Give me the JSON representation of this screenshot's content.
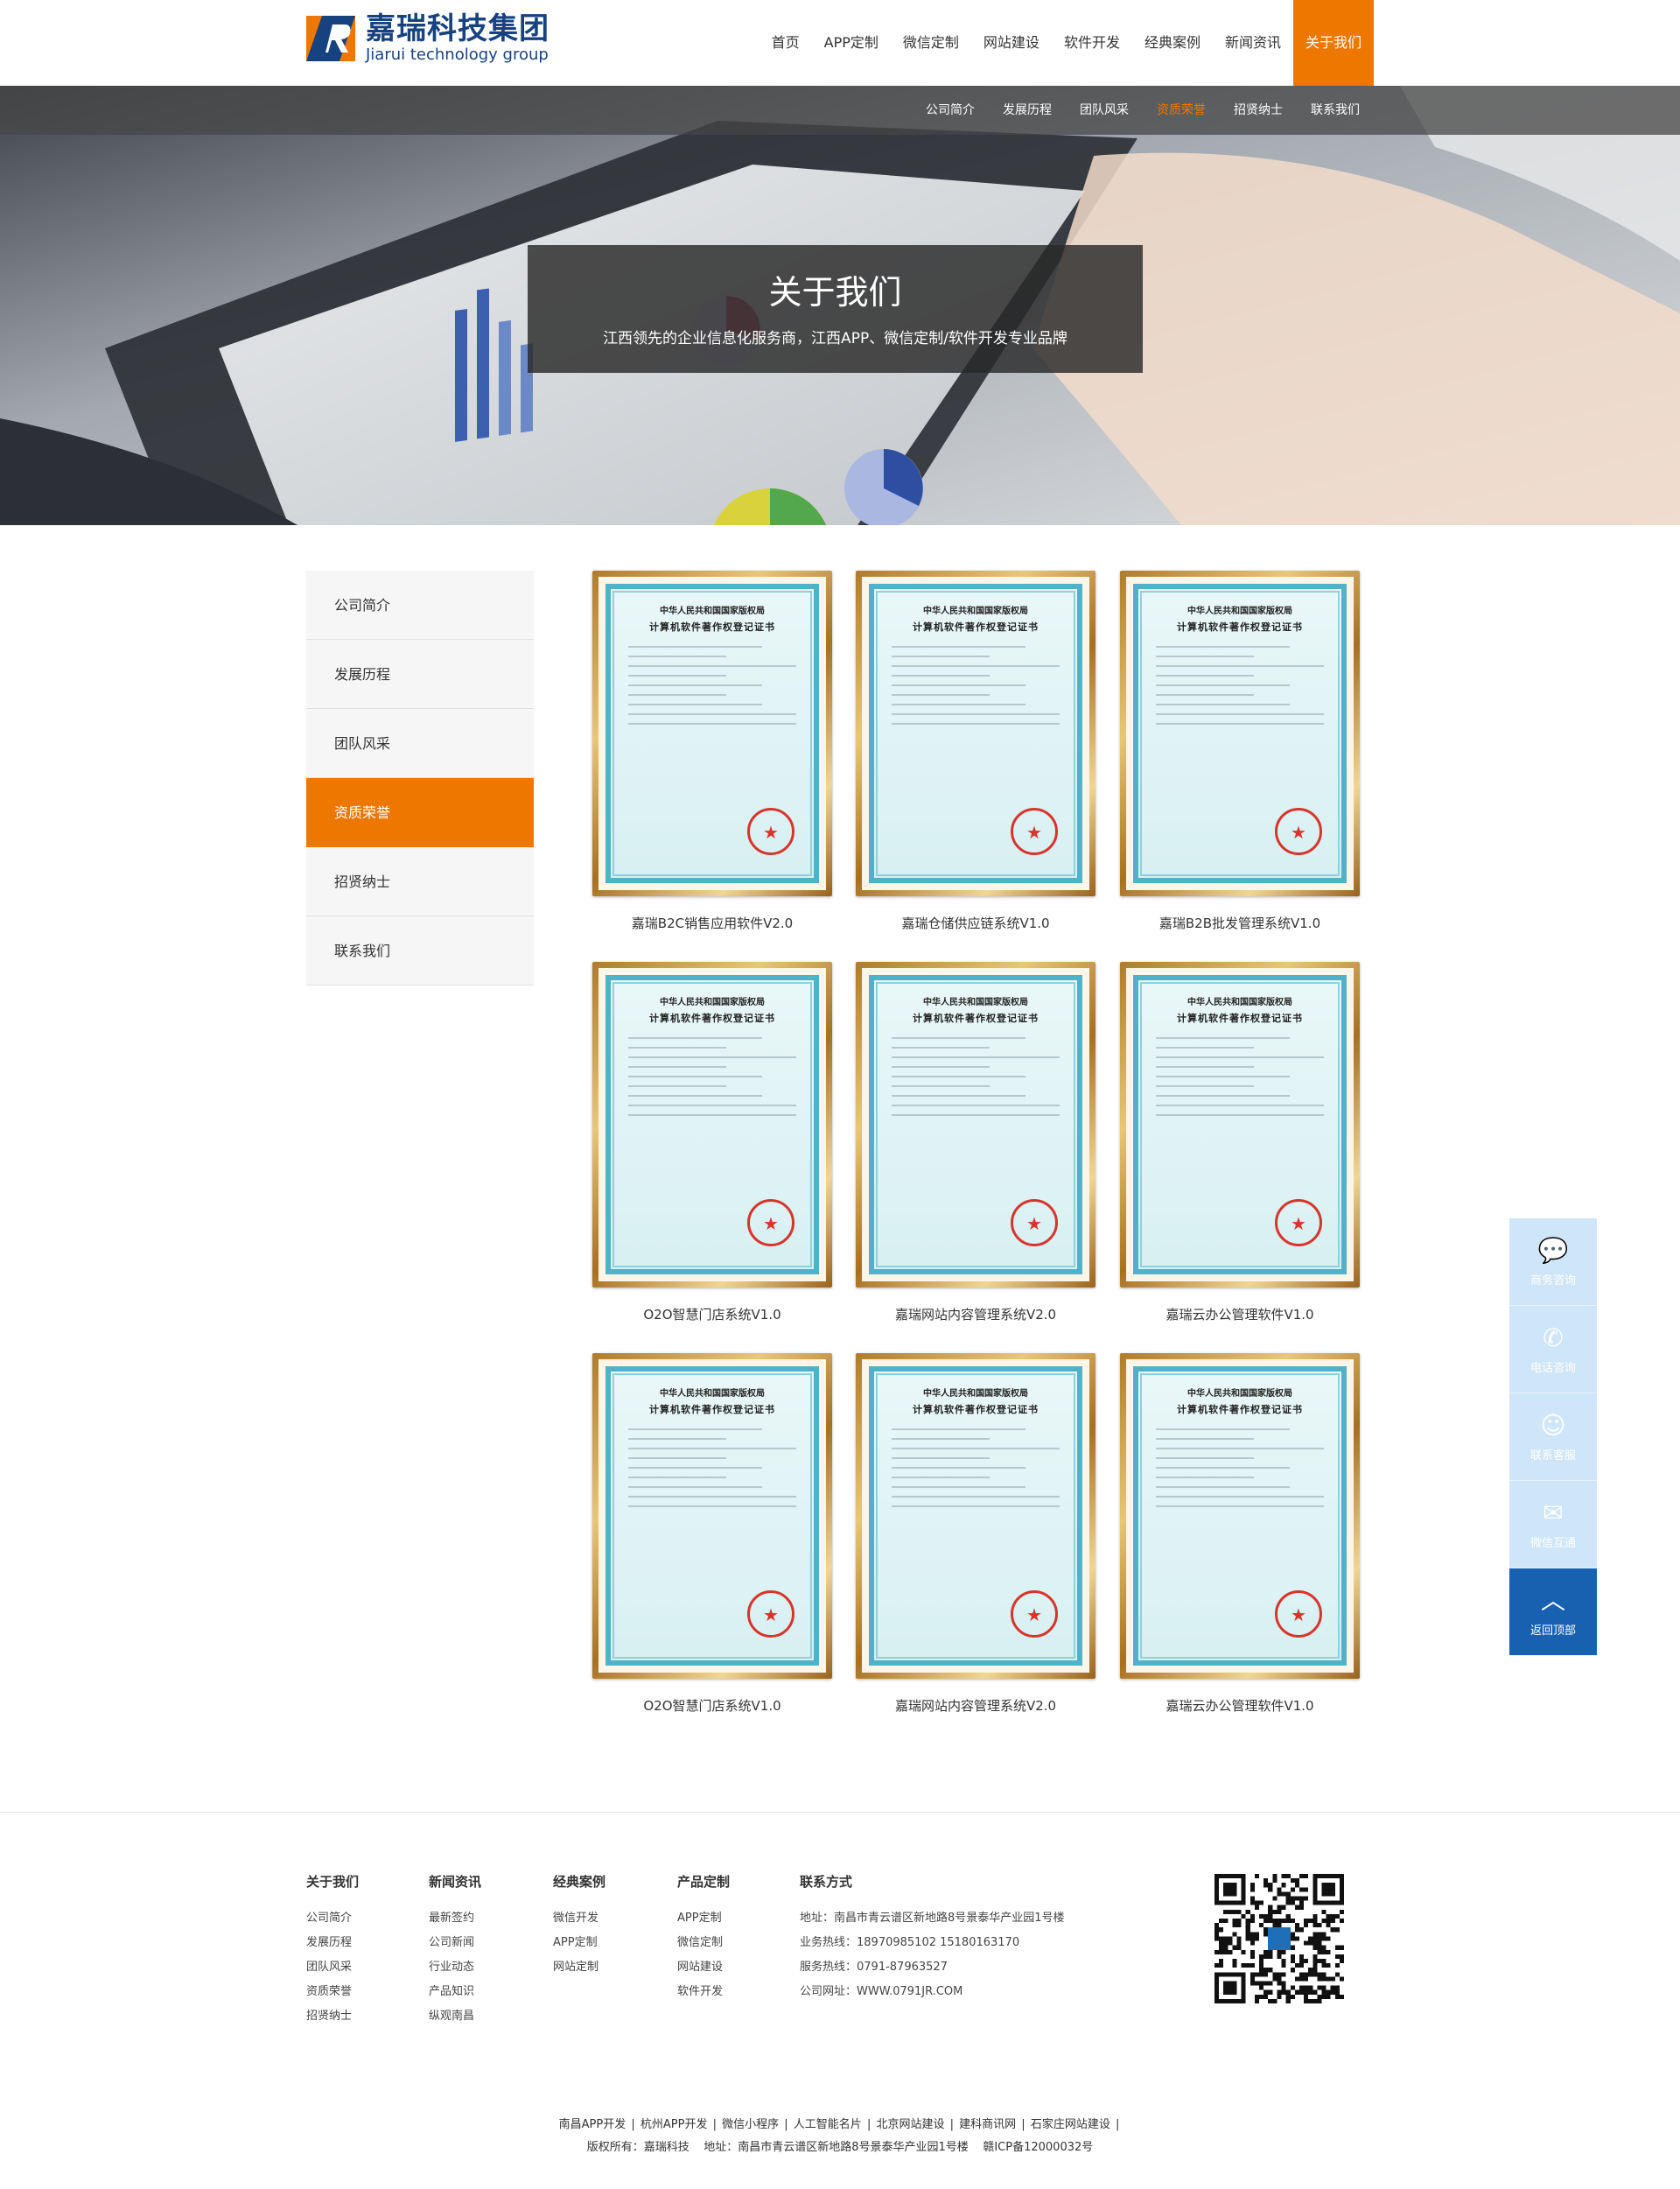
{
  "brand": {
    "cn": "嘉瑞科技集团",
    "en": "Jiarui technology group"
  },
  "nav": [
    {
      "label": "首页"
    },
    {
      "label": "APP定制"
    },
    {
      "label": "微信定制"
    },
    {
      "label": "网站建设"
    },
    {
      "label": "软件开发"
    },
    {
      "label": "经典案例"
    },
    {
      "label": "新闻资讯"
    },
    {
      "label": "关于我们",
      "active": true
    }
  ],
  "subnav": [
    {
      "label": "公司简介"
    },
    {
      "label": "发展历程"
    },
    {
      "label": "团队风采"
    },
    {
      "label": "资质荣誉",
      "active": true
    },
    {
      "label": "招贤纳士"
    },
    {
      "label": "联系我们"
    }
  ],
  "banner": {
    "title": "关于我们",
    "subtitle": "江西领先的企业信息化服务商，江西APP、微信定制/软件开发专业品牌"
  },
  "sidebar": [
    {
      "label": "公司简介"
    },
    {
      "label": "发展历程"
    },
    {
      "label": "团队风采"
    },
    {
      "label": "资质荣誉",
      "active": true
    },
    {
      "label": "招贤纳士"
    },
    {
      "label": "联系我们"
    }
  ],
  "certificate_text": {
    "line1": "中华人民共和国国家版权局",
    "line2": "计算机软件著作权登记证书"
  },
  "certificates": [
    {
      "caption": "嘉瑞B2C销售应用软件V2.0"
    },
    {
      "caption": "嘉瑞仓储供应链系统V1.0"
    },
    {
      "caption": "嘉瑞B2B批发管理系统V1.0"
    },
    {
      "caption": "O2O智慧门店系统V1.0"
    },
    {
      "caption": "嘉瑞网站内容管理系统V2.0"
    },
    {
      "caption": "嘉瑞云办公管理软件V1.0"
    },
    {
      "caption": "O2O智慧门店系统V1.0"
    },
    {
      "caption": "嘉瑞网站内容管理系统V2.0"
    },
    {
      "caption": "嘉瑞云办公管理软件V1.0"
    }
  ],
  "float_tools": [
    {
      "label": "商务咨询",
      "icon": "chat-icon"
    },
    {
      "label": "电话咨询",
      "icon": "phone-icon"
    },
    {
      "label": "联系客服",
      "icon": "qq-icon"
    },
    {
      "label": "微信互通",
      "icon": "wechat-icon"
    },
    {
      "label": "返回顶部",
      "icon": "arrow-up-icon"
    }
  ],
  "footer": {
    "about": {
      "title": "关于我们",
      "links": [
        "公司简介",
        "发展历程",
        "团队风采",
        "资质荣誉",
        "招贤纳士"
      ]
    },
    "news": {
      "title": "新闻资讯",
      "links": [
        "最新签约",
        "公司新闻",
        "行业动态",
        "产品知识",
        "纵观南昌"
      ]
    },
    "cases": {
      "title": "经典案例",
      "links": [
        "微信开发",
        "APP定制",
        "网站定制"
      ]
    },
    "products": {
      "title": "产品定制",
      "links": [
        "APP定制",
        "微信定制",
        "网站建设",
        "软件开发"
      ]
    },
    "contact": {
      "title": "联系方式",
      "lines": [
        "地址：南昌市青云谱区新地路8号景泰华产业园1号楼",
        "业务热线：18970985102 15180163170",
        "服务热线：0791-87963527",
        "公司网址：WWW.0791JR.COM"
      ]
    },
    "friend_links": [
      "南昌APP开发",
      "杭州APP开发",
      "微信小程序",
      "人工智能名片",
      "北京网站建设",
      "建科商讯网",
      "石家庄网站建设"
    ],
    "copyright": "版权所有：嘉瑞科技    地址：南昌市青云谱区新地路8号景泰华产业园1号楼    赣ICP备12000032号"
  },
  "colors": {
    "accent": "#ee7700",
    "brand_blue": "#16427f",
    "float_top": "#1861b1"
  }
}
